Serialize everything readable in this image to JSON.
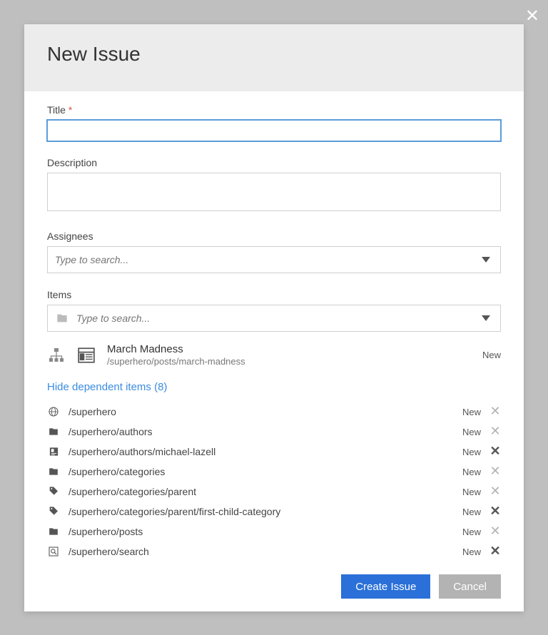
{
  "modal": {
    "title": "New Issue"
  },
  "fields": {
    "title_label": "Title",
    "title_value": "",
    "description_label": "Description",
    "description_value": "",
    "assignees_label": "Assignees",
    "assignees_placeholder": "Type to search...",
    "items_label": "Items",
    "items_placeholder": "Type to search..."
  },
  "selected": {
    "name": "March Madness",
    "path": "/superhero/posts/march-madness",
    "status": "New"
  },
  "dependents": {
    "toggle_label": "Hide dependent items (8)",
    "rows": [
      {
        "icon": "globe",
        "path": "/superhero",
        "status": "New",
        "remove_dark": false
      },
      {
        "icon": "folder",
        "path": "/superhero/authors",
        "status": "New",
        "remove_dark": false
      },
      {
        "icon": "card",
        "path": "/superhero/authors/michael-lazell",
        "status": "New",
        "remove_dark": true
      },
      {
        "icon": "folder",
        "path": "/superhero/categories",
        "status": "New",
        "remove_dark": false
      },
      {
        "icon": "tag",
        "path": "/superhero/categories/parent",
        "status": "New",
        "remove_dark": false
      },
      {
        "icon": "tag",
        "path": "/superhero/categories/parent/first-child-category",
        "status": "New",
        "remove_dark": true
      },
      {
        "icon": "folder",
        "path": "/superhero/posts",
        "status": "New",
        "remove_dark": false
      },
      {
        "icon": "search",
        "path": "/superhero/search",
        "status": "New",
        "remove_dark": true
      }
    ]
  },
  "footer": {
    "primary": "Create Issue",
    "secondary": "Cancel"
  }
}
